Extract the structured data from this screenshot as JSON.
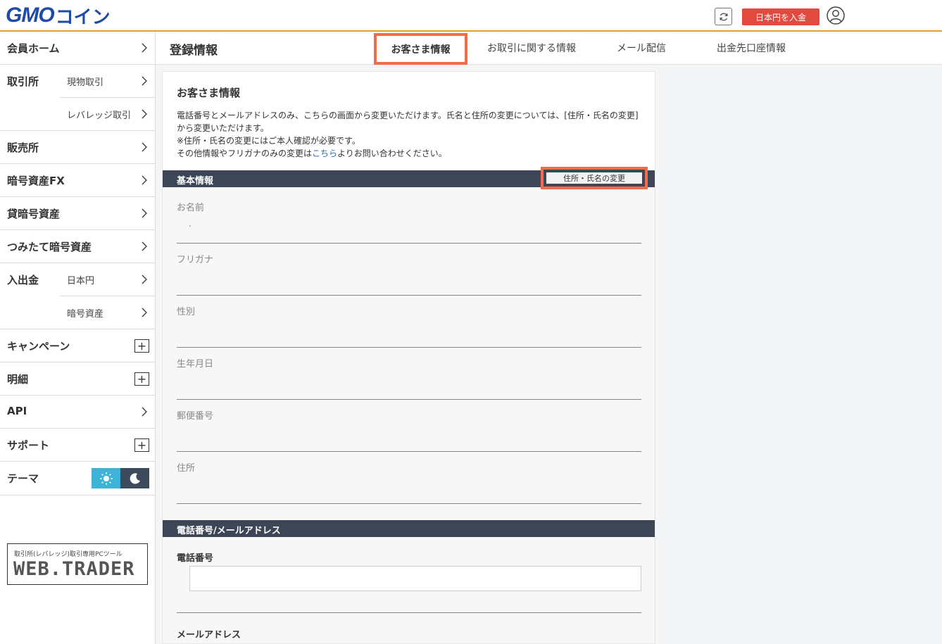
{
  "header": {
    "logo_gmo": "GMO",
    "logo_coin": "コイン",
    "deposit_label": "日本円を入金"
  },
  "sidebar": {
    "member_home": "会員ホーム",
    "exchange": "取引所",
    "exchange_spot": "現物取引",
    "exchange_leverage": "レバレッジ取引",
    "sales": "販売所",
    "crypto_fx": "暗号資産FX",
    "lending": "貸暗号資産",
    "accumulate": "つみたて暗号資産",
    "deposit_withdraw": "入出金",
    "dw_jpy": "日本円",
    "dw_crypto": "暗号資産",
    "campaign": "キャンペーン",
    "statement": "明細",
    "api": "API",
    "support": "サポート",
    "theme": "テーマ"
  },
  "web_trader": {
    "caption": "取引所(レバレッジ)取引専用PCツール",
    "logo": "WEB.TRADER"
  },
  "topbar": {
    "page_title": "登録情報",
    "tabs": [
      "お客さま情報",
      "お取引に関する情報",
      "メール配信",
      "出金先口座情報"
    ]
  },
  "card": {
    "title": "お客さま情報",
    "desc_line1": "電話番号とメールアドレスのみ、こちらの画面から変更いただけます。氏名と住所の変更については、[住所・氏名の変更]",
    "desc_line2": "から変更いただけます。",
    "desc_line3": "※住所・氏名の変更にはご本人確認が必要です。",
    "desc_line4_pre": "その他情報やフリガナのみの変更は",
    "desc_line4_link": "こちら",
    "desc_line4_post": "よりお問い合わせください。"
  },
  "basic_info": {
    "section_title": "基本情報",
    "change_button": "住所・氏名の変更",
    "fields": [
      "お名前",
      "フリガナ",
      "性別",
      "生年月日",
      "郵便番号",
      "住所"
    ]
  },
  "contact": {
    "section_title": "電話番号/メールアドレス",
    "phone_label": "電話番号",
    "email_label": "メールアドレス"
  },
  "colors": {
    "brand_blue": "#1e4aa8",
    "accent_red": "#e2493f",
    "highlight": "#f26b4b",
    "section_bar": "#3d4656",
    "header_line": "#e0a32a"
  }
}
